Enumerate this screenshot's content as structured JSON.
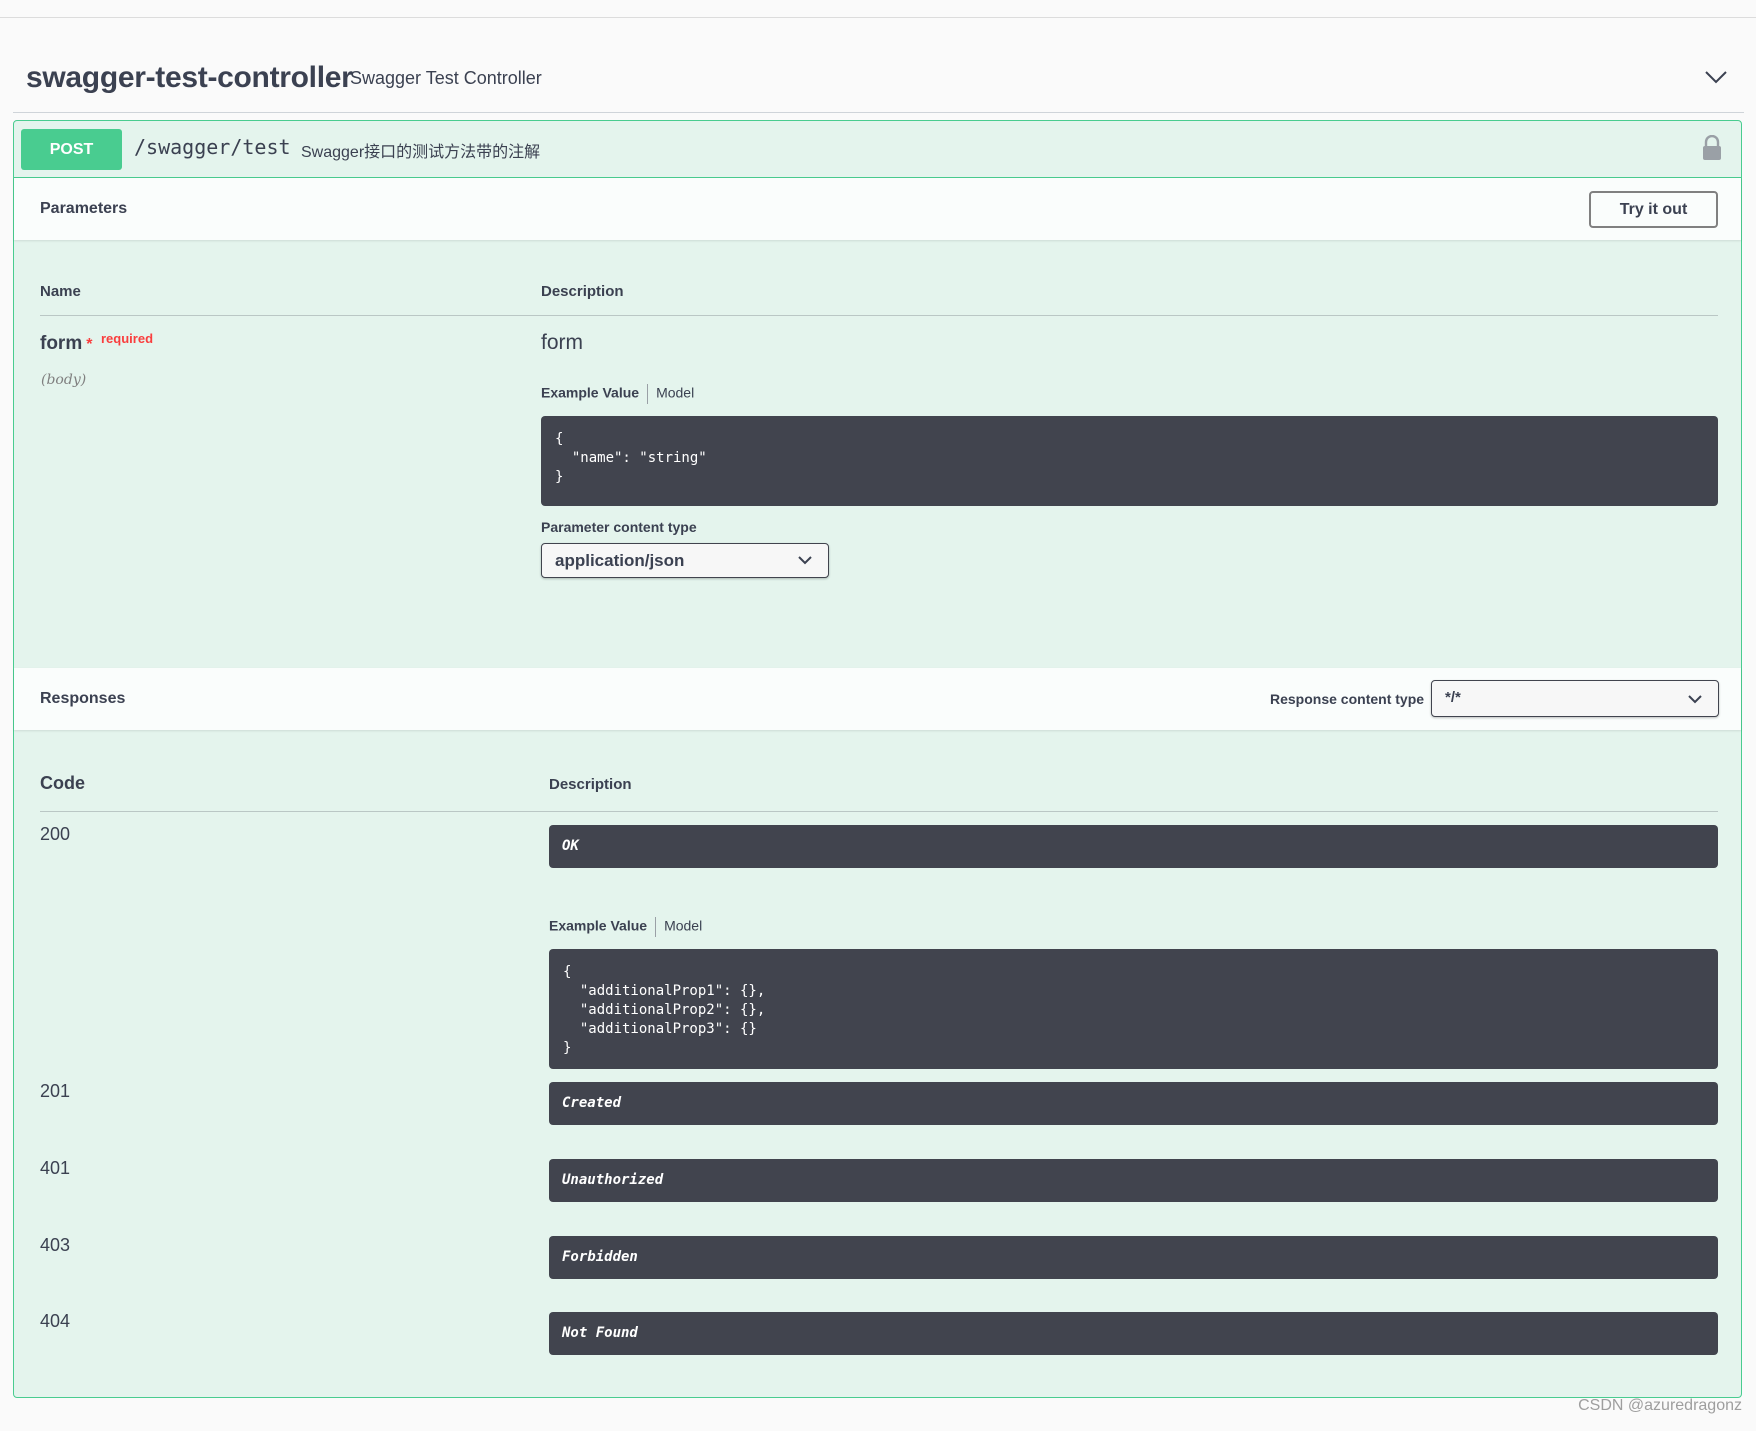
{
  "tag": {
    "name": "swagger-test-controller",
    "description": "Swagger Test Controller",
    "toggle_icon": "chevron-down-icon"
  },
  "operation": {
    "method": "POST",
    "path": "/swagger/test",
    "summary": "Swagger接口的测试方法带的注解",
    "lock_icon": "lock-icon",
    "method_color": "#49cc90"
  },
  "parameters": {
    "title": "Parameters",
    "try_label": "Try it out",
    "col_name": "Name",
    "col_description": "Description",
    "items": [
      {
        "name": "form",
        "required_marker": "*",
        "required_label": "required",
        "in": "(body)",
        "description": "form",
        "tab_example": "Example Value",
        "tab_model": "Model",
        "example": "{\n  \"name\": \"string\"\n}",
        "content_type_label": "Parameter content type",
        "content_type": "application/json"
      }
    ]
  },
  "responses": {
    "title": "Responses",
    "content_type_label": "Response content type",
    "content_type": "*/*",
    "col_code": "Code",
    "col_description": "Description",
    "items": [
      {
        "code": "200",
        "description": "OK",
        "tab_example": "Example Value",
        "tab_model": "Model",
        "example": "{\n  \"additionalProp1\": {},\n  \"additionalProp2\": {},\n  \"additionalProp3\": {}\n}"
      },
      {
        "code": "201",
        "description": "Created"
      },
      {
        "code": "401",
        "description": "Unauthorized"
      },
      {
        "code": "403",
        "description": "Forbidden"
      },
      {
        "code": "404",
        "description": "Not Found"
      }
    ]
  },
  "watermark": "CSDN @azuredragonz"
}
